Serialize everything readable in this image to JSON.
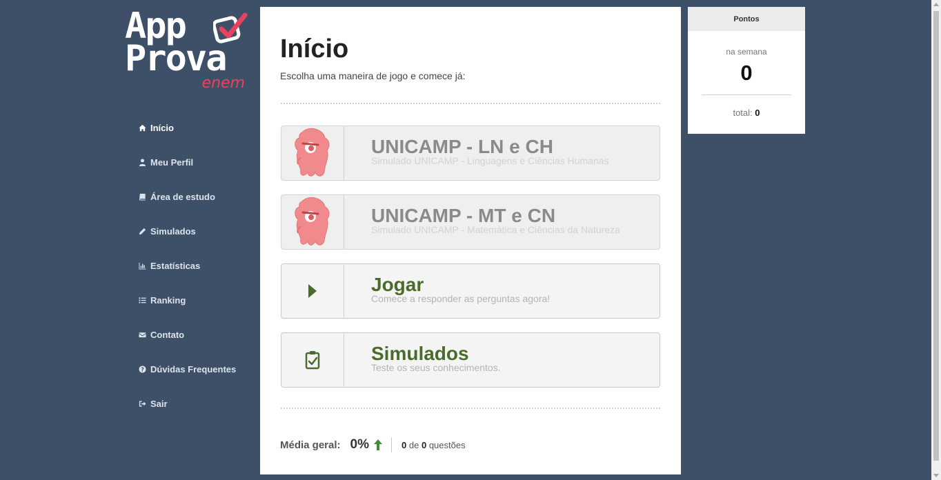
{
  "logo": {
    "line1": "App",
    "line2": "Prova",
    "line3": "enem"
  },
  "sidebar": {
    "items": [
      {
        "label": "Início",
        "icon": "home-icon"
      },
      {
        "label": "Meu Perfil",
        "icon": "user-icon"
      },
      {
        "label": "Área de estudo",
        "icon": "book-icon"
      },
      {
        "label": "Simulados",
        "icon": "pencil-icon"
      },
      {
        "label": "Estatísticas",
        "icon": "bar-chart-icon"
      },
      {
        "label": "Ranking",
        "icon": "list-icon"
      },
      {
        "label": "Contato",
        "icon": "envelope-icon"
      },
      {
        "label": "Dúvidas Frequentes",
        "icon": "question-icon"
      },
      {
        "label": "Sair",
        "icon": "sign-out-icon"
      }
    ]
  },
  "main": {
    "title": "Início",
    "subtitle": "Escolha uma maneira de jogo e comece já:",
    "cards": [
      {
        "title": "UNICAMP - LN e CH",
        "desc": "Simulado UNICAMP - Linguagens e Ciências Humanas",
        "icon": "monster-icon"
      },
      {
        "title": "UNICAMP - MT e CN",
        "desc": "Simulado UNICAMP - Matemática e Ciências da Natureza",
        "icon": "monster-icon"
      },
      {
        "title": "Jogar",
        "desc": "Comece a responder as perguntas agora!",
        "icon": "play-icon"
      },
      {
        "title": "Simulados",
        "desc": "Teste os seus conhecimentos.",
        "icon": "clipboard-check-icon"
      }
    ],
    "stats": {
      "label": "Média geral:",
      "value": "0%",
      "answered": "0",
      "of_word": "de",
      "total": "0",
      "questions_word": "questões"
    }
  },
  "points": {
    "header": "Pontos",
    "week_label": "na semana",
    "week_value": "0",
    "total_label": "total:",
    "total_value": "0"
  },
  "colors": {
    "background": "#3e5068",
    "accent_red": "#e8435d",
    "card_green": "#4a6b2b"
  }
}
